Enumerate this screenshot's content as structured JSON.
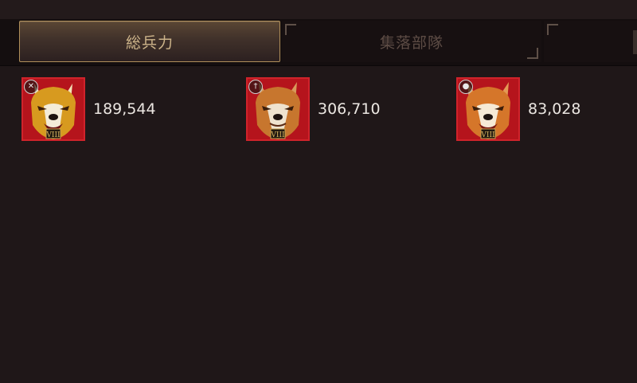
{
  "tabs": [
    {
      "label": "総兵力",
      "active": true
    },
    {
      "label": "集落部隊",
      "active": false
    }
  ],
  "units": [
    {
      "count": "189,544",
      "icon": "crossed-weapons-icon",
      "tier": "VIII",
      "fur_color": "#d79a1f"
    },
    {
      "count": "306,710",
      "icon": "sword-icon",
      "tier": "VIII",
      "fur_color": "#c7762e"
    },
    {
      "count": "83,028",
      "icon": "boulder-icon",
      "tier": "VIII",
      "fur_color": "#d5762a"
    }
  ],
  "colors": {
    "background": "#1f1718",
    "tab_active_text": "#cdb48a",
    "tab_inactive_text": "#5d4c45",
    "portrait_border": "#d0232b",
    "portrait_bg": "#b5141c"
  }
}
